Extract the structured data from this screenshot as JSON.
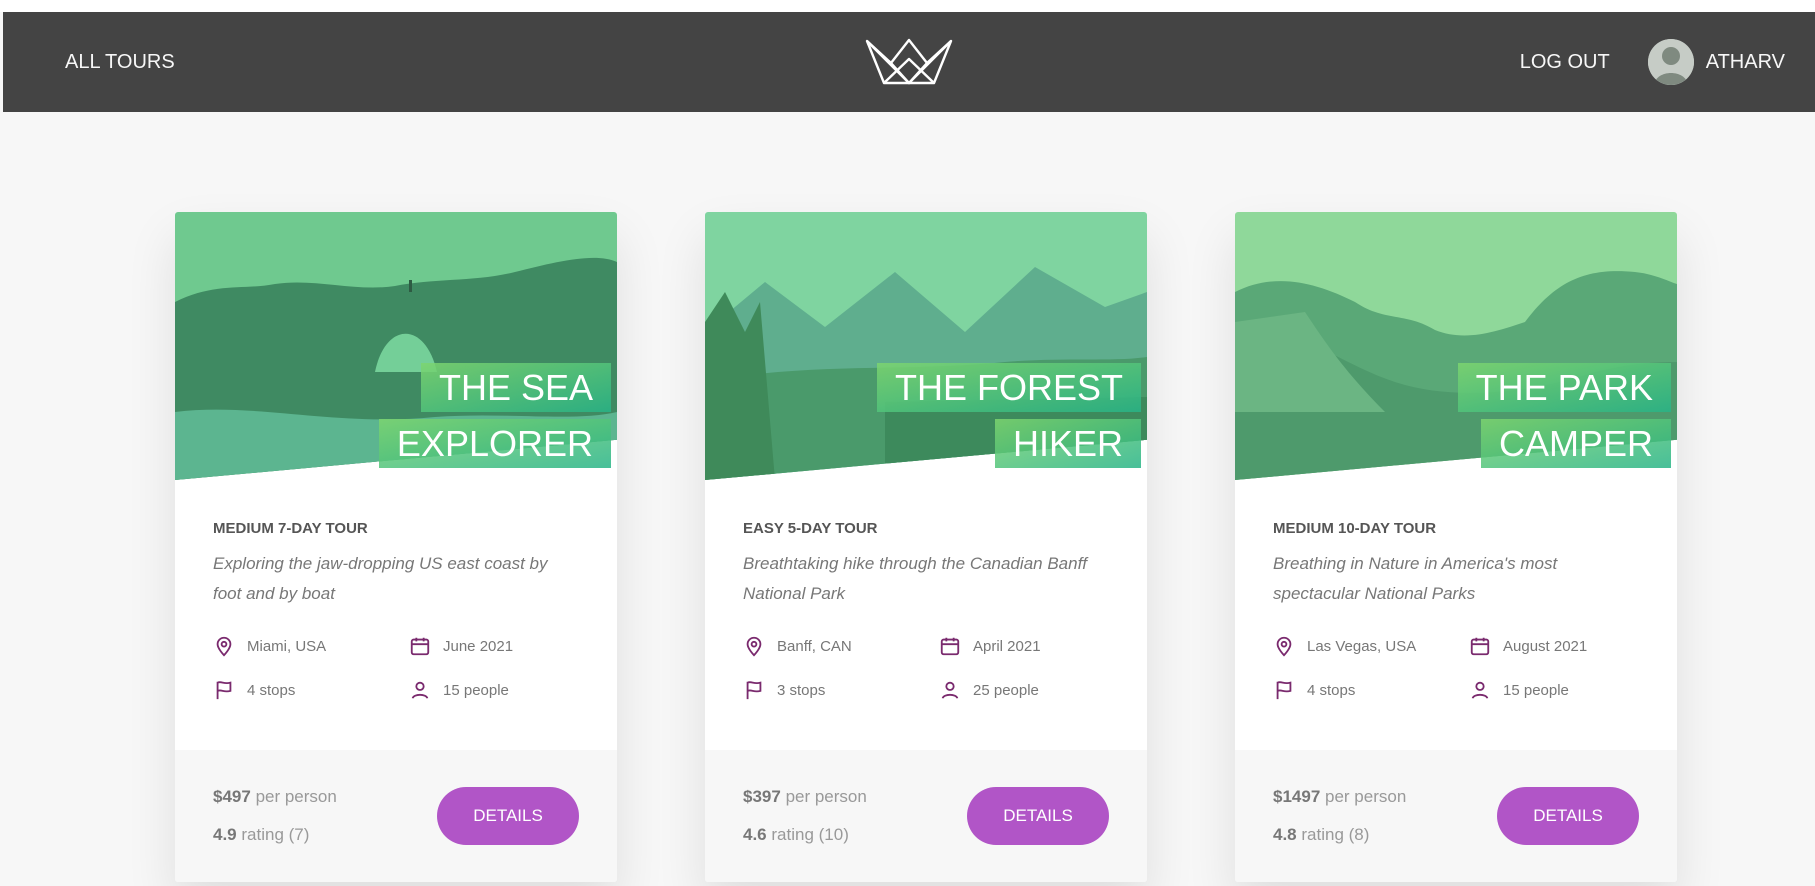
{
  "header": {
    "all_tours_label": "ALL TOURS",
    "logout_label": "LOG OUT",
    "user_name": "ATHARV"
  },
  "colors": {
    "header_bg": "#444444",
    "accent_purple": "#b155c7",
    "icon_purple": "#7a2a6e",
    "image_overlay_green": "#7dd56f"
  },
  "tours": [
    {
      "title_line1": "THE SEA",
      "title_line2": "EXPLORER",
      "difficulty": "MEDIUM 7-DAY TOUR",
      "summary": "Exploring the jaw-dropping US east coast by foot and by boat",
      "location": "Miami, USA",
      "date": "June 2021",
      "stops": "4 stops",
      "people": "15 people",
      "price": "$497",
      "price_suffix": "per person",
      "rating": "4.9",
      "rating_suffix": "rating (7)",
      "button_label": "DETAILS"
    },
    {
      "title_line1": "THE FOREST",
      "title_line2": "HIKER",
      "difficulty": "EASY 5-DAY TOUR",
      "summary": "Breathtaking hike through the Canadian Banff National Park",
      "location": "Banff, CAN",
      "date": "April 2021",
      "stops": "3 stops",
      "people": "25 people",
      "price": "$397",
      "price_suffix": "per person",
      "rating": "4.6",
      "rating_suffix": "rating (10)",
      "button_label": "DETAILS"
    },
    {
      "title_line1": "THE PARK",
      "title_line2": "CAMPER",
      "difficulty": "MEDIUM 10-DAY TOUR",
      "summary": "Breathing in Nature in America's most spectacular National Parks",
      "location": "Las Vegas, USA",
      "date": "August 2021",
      "stops": "4 stops",
      "people": "15 people",
      "price": "$1497",
      "price_suffix": "per person",
      "rating": "4.8",
      "rating_suffix": "rating (8)",
      "button_label": "DETAILS"
    }
  ]
}
